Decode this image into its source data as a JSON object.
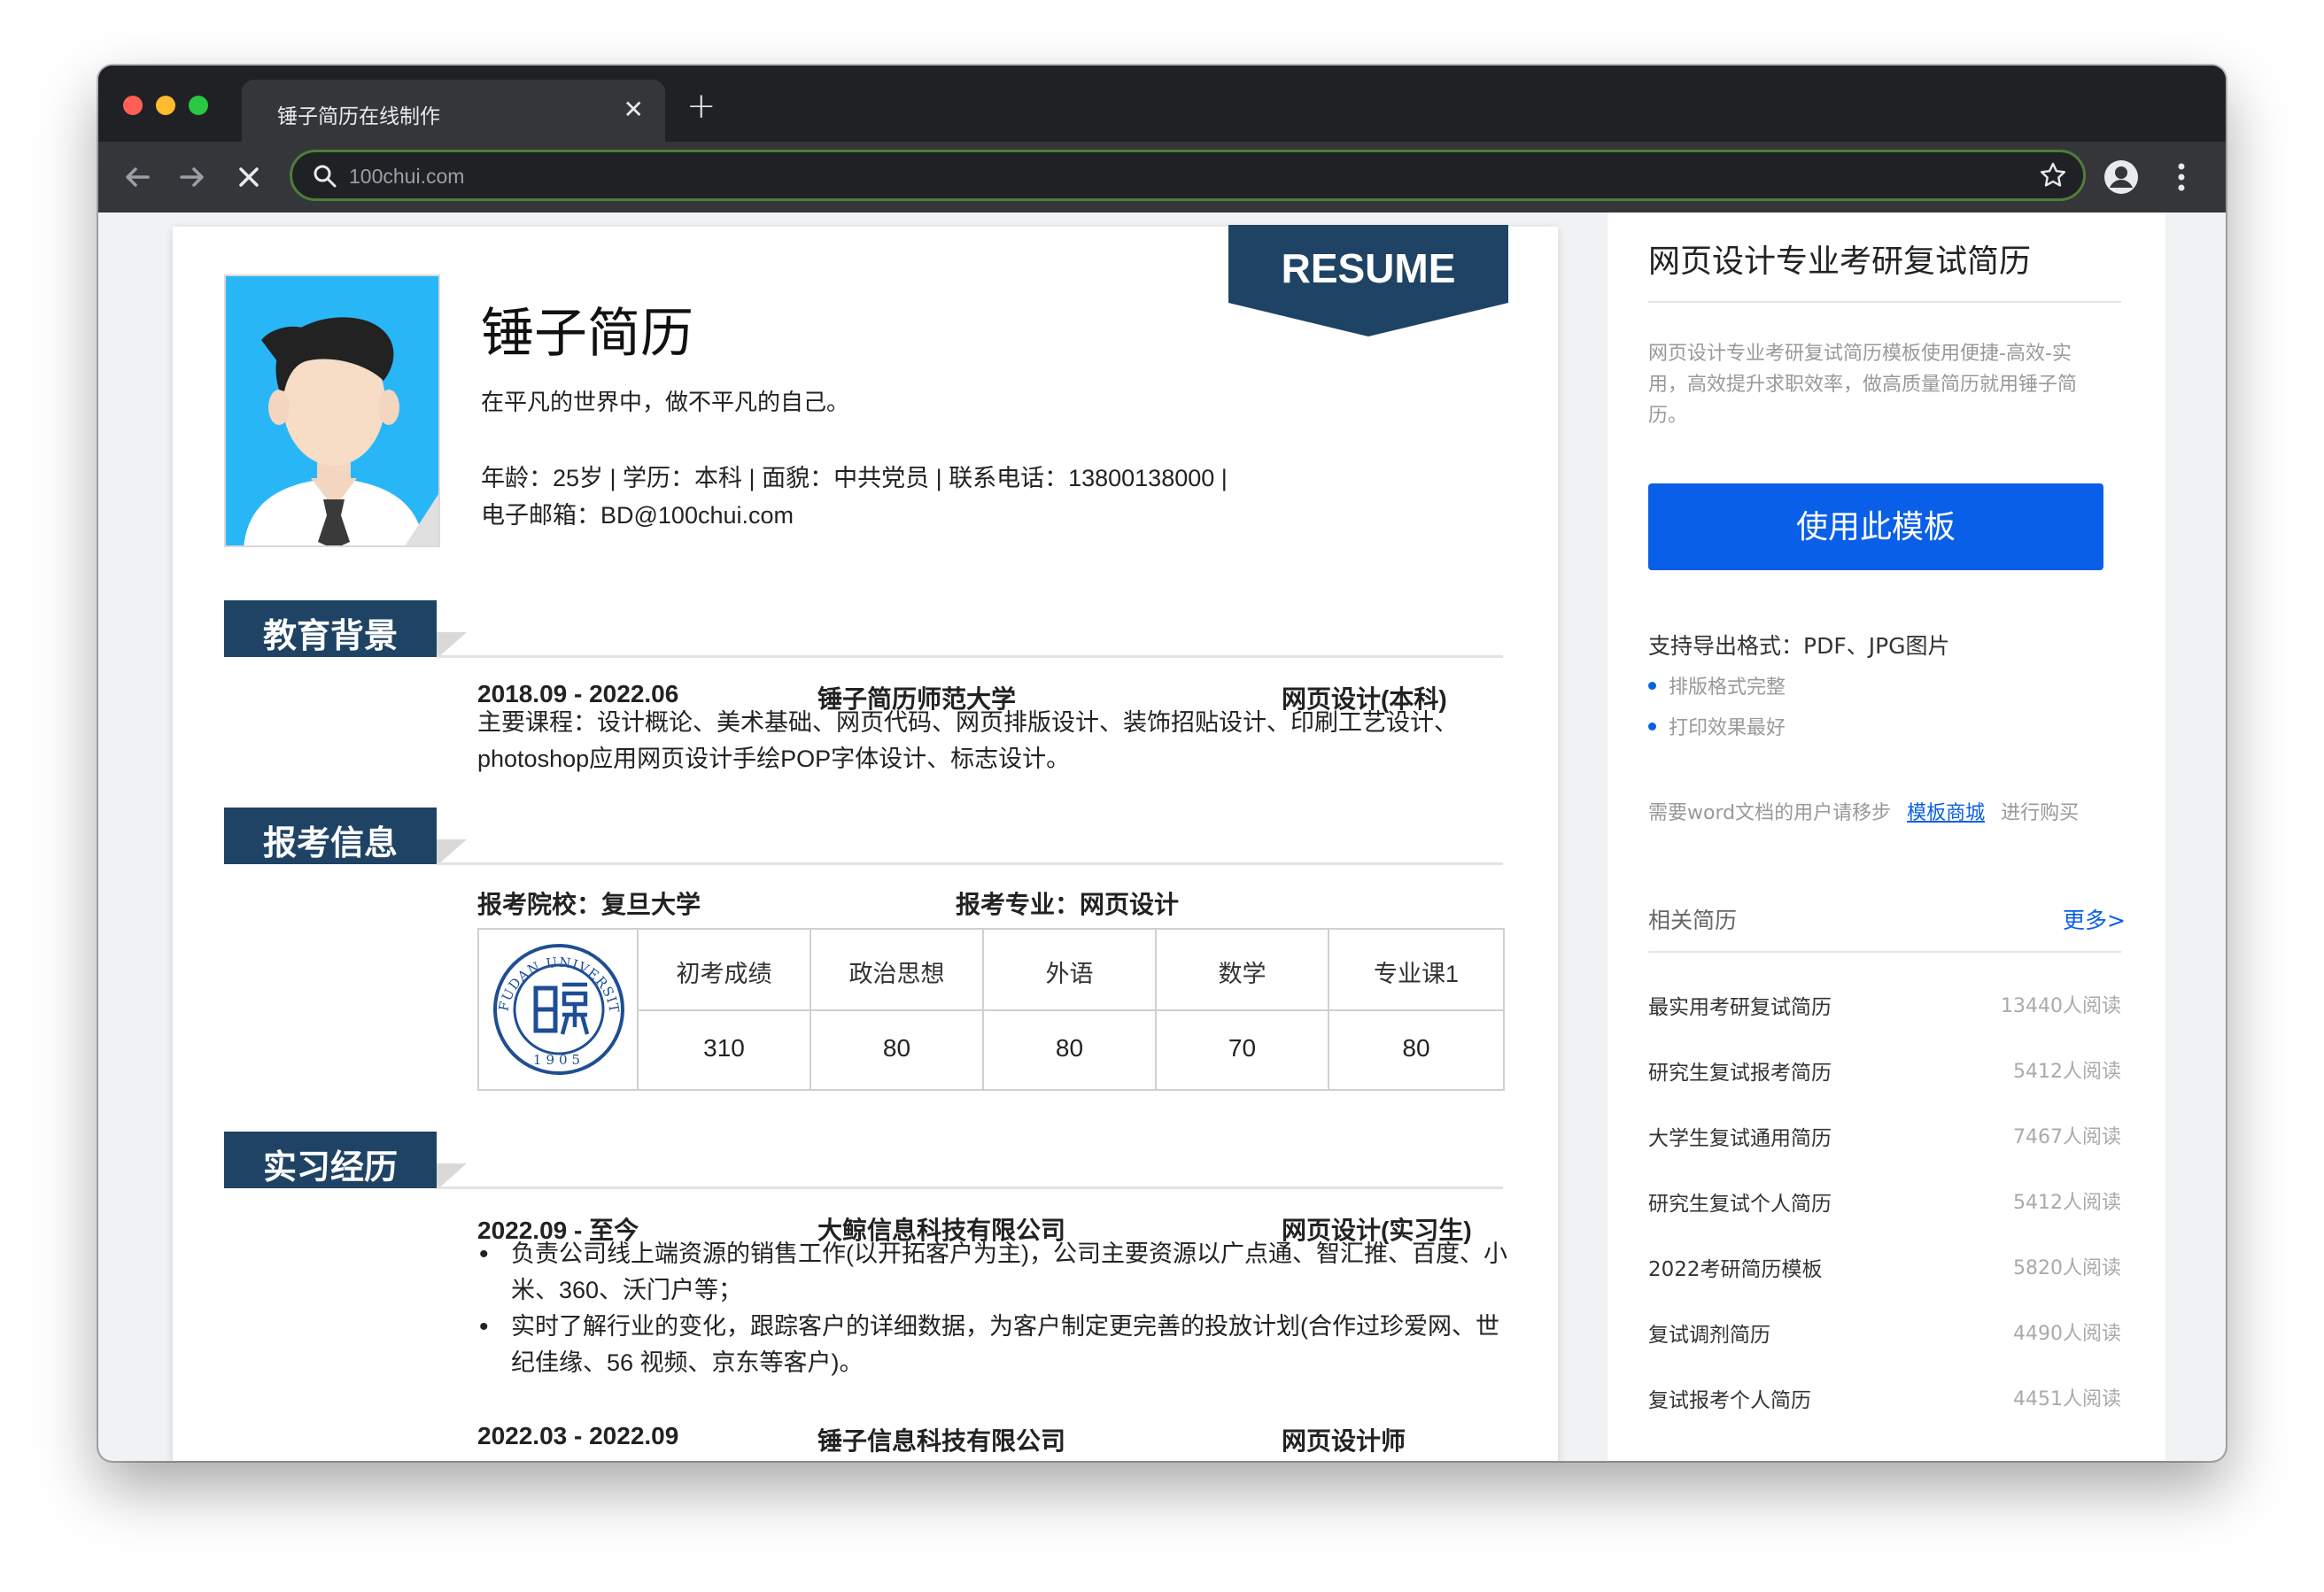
{
  "browser": {
    "tab_title": "锤子简历在线制作",
    "tab_close": "✕",
    "new_tab": "+",
    "url": "100chui.com"
  },
  "resume": {
    "ribbon": "RESUME",
    "name": "锤子简历",
    "motto": "在平凡的世界中，做不平凡的自己。",
    "info_line1": "年龄：25岁 | 学历：本科 | 面貌：中共党员 | 联系电话：13800138000 |",
    "info_line2": "电子邮箱：BD@100chui.com",
    "education": {
      "heading": "教育背景",
      "period": "2018.09 - 2022.06",
      "school": "锤子简历师范大学",
      "major": "网页设计(本科)",
      "courses_line1": "主要课程：设计概论、美术基础、网页代码、网页排版设计、装饰招贴设计、印刷工艺设计、",
      "courses_line2": "photoshop应用网页设计手绘POP字体设计、标志设计。"
    },
    "exam": {
      "heading": "报考信息",
      "school": "报考院校：复旦大学",
      "major": "报考专业：网页设计",
      "headers": [
        "初考成绩",
        "政治思想",
        "外语",
        "数学",
        "专业课1"
      ],
      "values": [
        "310",
        "80",
        "80",
        "70",
        "80"
      ]
    },
    "internship": {
      "heading": "实习经历",
      "job1_period": "2022.09 - 至今",
      "job1_company": "大鲸信息科技有限公司",
      "job1_role": "网页设计(实习生)",
      "bullet1_line1": "负责公司线上端资源的销售工作(以开拓客户为主)，公司主要资源以广点通、智汇推、百度、小",
      "bullet1_line2": "米、360、沃门户等；",
      "bullet2_line1": "实时了解行业的变化，跟踪客户的详细数据，为客户制定更完善的投放计划(合作过珍爱网、世",
      "bullet2_line2": "纪佳缘、56 视频、京东等客户)。",
      "job2_period": "2022.03 - 2022.09",
      "job2_company": "锤子信息科技有限公司",
      "job2_role": "网页设计师"
    }
  },
  "sidebar": {
    "title": "网页设计专业考研复试简历",
    "desc": "网页设计专业考研复试简历模板使用便捷-高效-实用，高效提升求职效率，做高质量简历就用锤子简历。",
    "use_button": "使用此模板",
    "export": "支持导出格式：PDF、JPG图片",
    "feature1": "排版格式完整",
    "feature2": "打印效果最好",
    "word_prefix": "需要word文档的用户请移步",
    "word_link": "模板商城",
    "word_suffix": "进行购买",
    "related_label": "相关简历",
    "more_link": "更多>",
    "related": [
      {
        "name": "最实用考研复试简历",
        "count": "13440人阅读"
      },
      {
        "name": "研究生复试报考简历",
        "count": "5412人阅读"
      },
      {
        "name": "大学生复试通用简历",
        "count": "7467人阅读"
      },
      {
        "name": "研究生复试个人简历",
        "count": "5412人阅读"
      },
      {
        "name": "2022考研简历模板",
        "count": "5820人阅读"
      },
      {
        "name": "复试调剂简历",
        "count": "4490人阅读"
      },
      {
        "name": "复试报考个人简历",
        "count": "4451人阅读"
      }
    ]
  },
  "colors": {
    "navy": "#1e4364",
    "accent_blue": "#0a5fe8",
    "chrome_dark": "#202124",
    "chrome_toolbar": "#35363a"
  }
}
